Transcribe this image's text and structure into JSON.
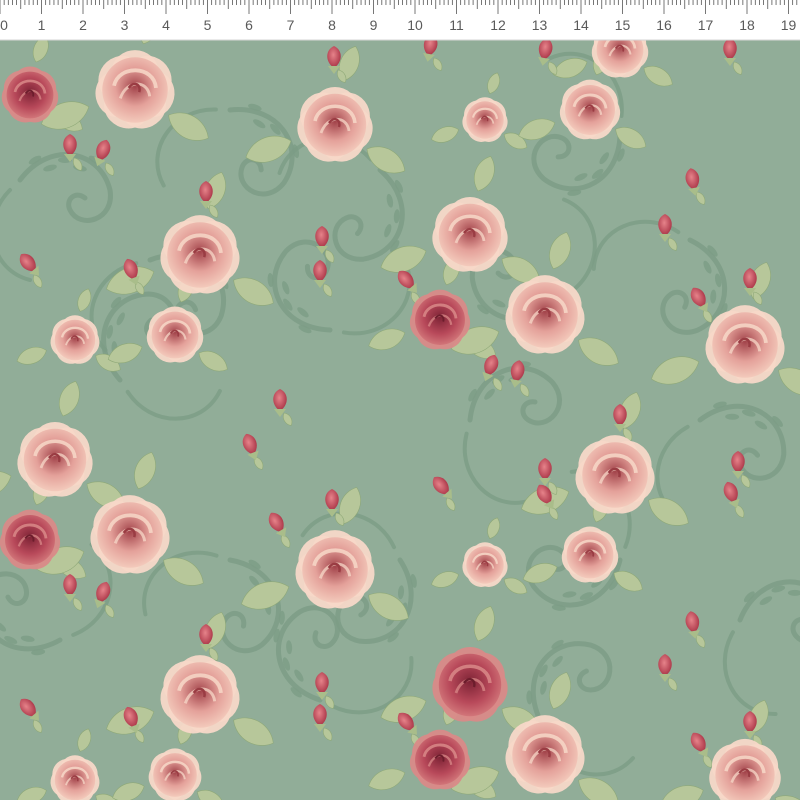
{
  "ruler": {
    "labels": [
      "0",
      "1",
      "2",
      "3",
      "4",
      "5",
      "6",
      "7",
      "8",
      "9",
      "10",
      "11",
      "12",
      "13",
      "14",
      "15",
      "16",
      "17",
      "18",
      "19"
    ]
  },
  "swatch": {
    "colors": {
      "background": "#91ad98",
      "flourish": "#7c9c86",
      "rose_dark": "#b8495a",
      "rose_pink": "#e4a19a",
      "rose_light": "#f6d2c2",
      "leaf": "#b7c79a",
      "ruler": "#ffffff"
    }
  }
}
